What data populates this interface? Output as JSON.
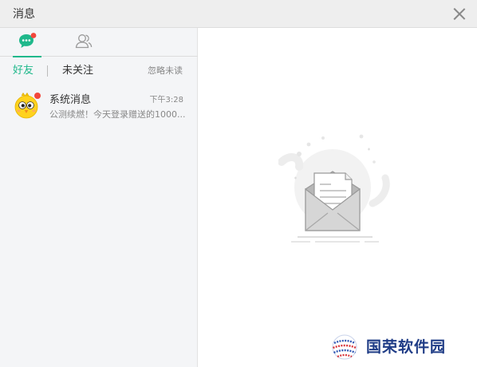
{
  "window": {
    "title": "消息"
  },
  "icons": {
    "close": "close-icon",
    "chat_tab": "chat-bubble-icon",
    "contacts_tab": "contacts-icon",
    "empty_state": "envelope-letter-icon"
  },
  "colors": {
    "accent": "#1fb88b",
    "unread_dot": "#f2463b",
    "panel_bg": "#f4f5f7",
    "titlebar_bg": "#eeeeee"
  },
  "filters": {
    "friends": "好友",
    "unfollowed": "未关注",
    "ignore_unread": "忽略未读"
  },
  "messages": [
    {
      "name": "系统消息",
      "time": "下午3:28",
      "preview": "公测续燃！今天登录赠送的1000...",
      "unread": true
    }
  ],
  "watermark": {
    "text": "国荣软件园"
  }
}
